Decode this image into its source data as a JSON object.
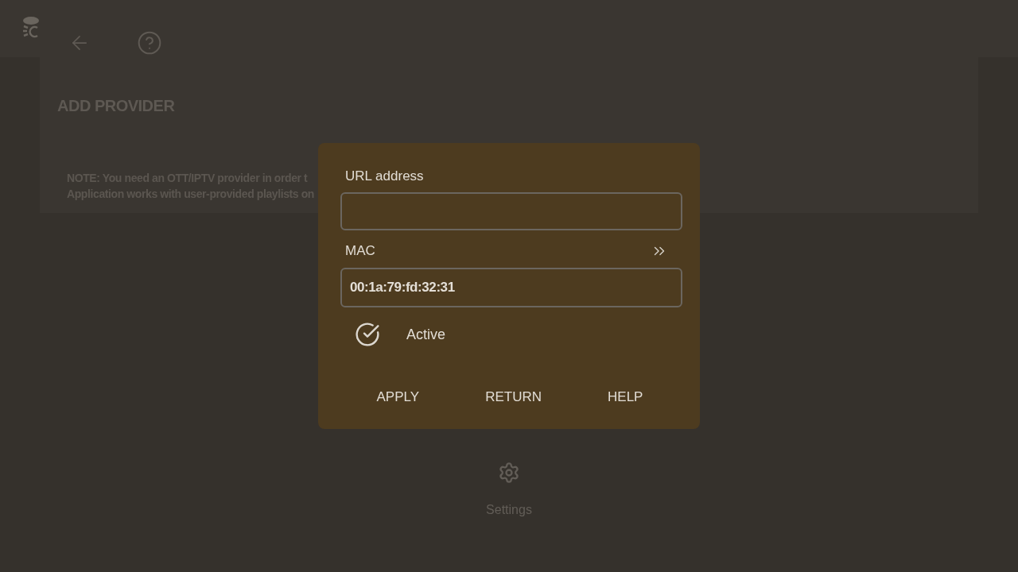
{
  "header": {
    "title": "ADD PROVIDER",
    "note_lines": [
      "NOTE: You need an OTT/IPTV provider in order t",
      "Application works with user-provided playlists on"
    ]
  },
  "dialog": {
    "fields": [
      {
        "kind": "plain",
        "label": "URL address"
      },
      {
        "kind": "with_action",
        "label": "MAC",
        "value": "00:1a:79:fd:32:31"
      }
    ],
    "active": {
      "label": "Active",
      "checked": true
    },
    "buttons": [
      "APPLY",
      "RETURN",
      "HELP"
    ]
  },
  "menu_item": {
    "label": "Settings"
  }
}
